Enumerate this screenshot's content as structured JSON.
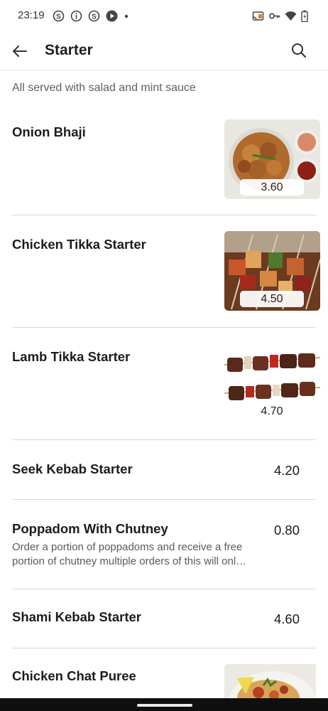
{
  "status_bar": {
    "time": "23:19",
    "left_icons": [
      "s-app-icon",
      "info-icon",
      "s-app-icon",
      "media-icon",
      "dot-icon"
    ],
    "right_icons": [
      "cast-icon",
      "key-icon",
      "wifi-icon",
      "battery-icon"
    ]
  },
  "header": {
    "title": "Starter",
    "back_icon": "arrow-left-icon",
    "search_icon": "search-icon"
  },
  "subtitle": "All served with salad and mint sauce",
  "items": [
    {
      "name": "Onion Bhaji",
      "price": "3.60",
      "has_image": true
    },
    {
      "name": "Chicken Tikka Starter",
      "price": "4.50",
      "has_image": true
    },
    {
      "name": "Lamb Tikka Starter",
      "price": "4.70",
      "has_image": true
    },
    {
      "name": "Seek Kebab Starter",
      "price": "4.20",
      "has_image": false
    },
    {
      "name": "Poppadom With Chutney",
      "price": "0.80",
      "has_image": false,
      "description": "Order a portion of poppadoms and receive a free portion of chutney multiple orders of this will onl…"
    },
    {
      "name": "Shami Kebab Starter",
      "price": "4.60",
      "has_image": false
    },
    {
      "name": "Chicken Chat Puree",
      "has_image": true
    }
  ]
}
